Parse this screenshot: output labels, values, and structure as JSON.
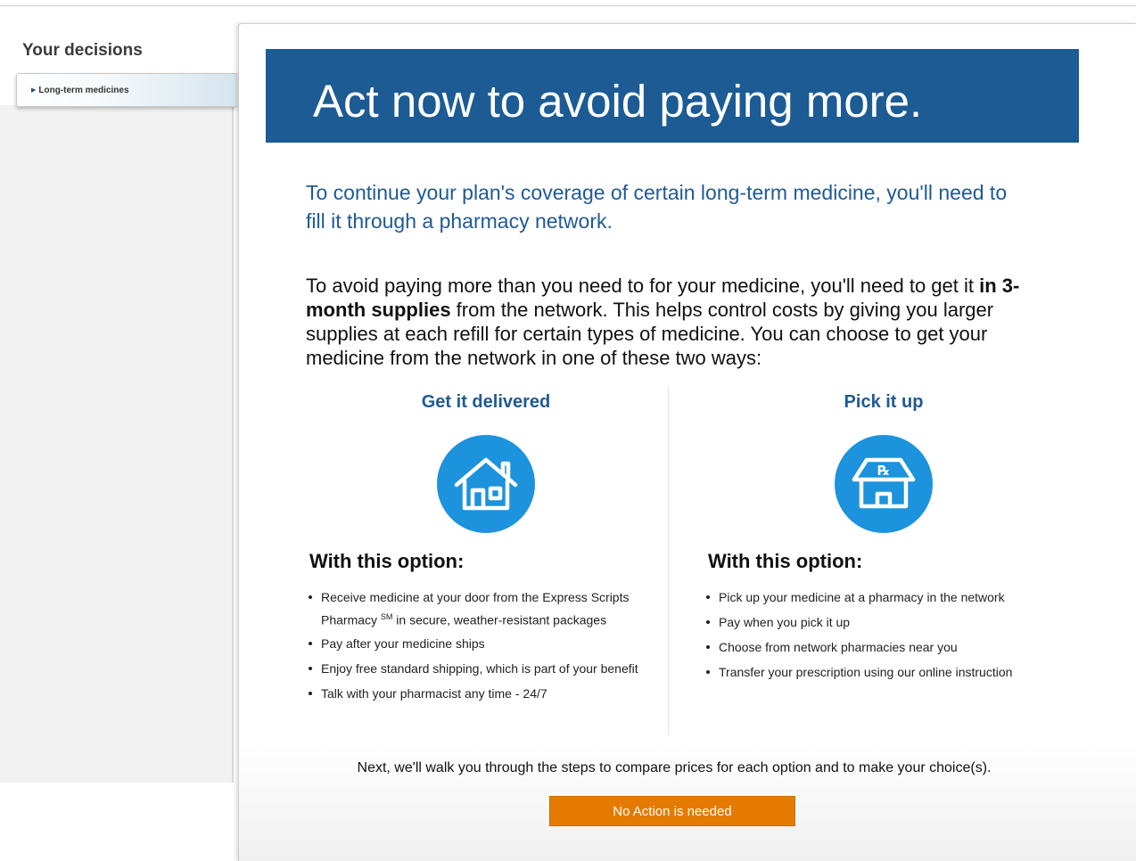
{
  "sidebar": {
    "title": "Your decisions",
    "items": [
      {
        "label": "Long-term medicines"
      }
    ]
  },
  "banner": {
    "title": "Act now to avoid paying more."
  },
  "main": {
    "lead": "To continue your plan's coverage of certain long-term medicine, you'll need to fill it through a pharmacy network.",
    "body_before_bold": "To avoid paying more than you need to for your medicine, you'll need to get it ",
    "body_bold": "in 3-month supplies",
    "body_after_bold": " from the network. This helps control costs by giving you larger supplies at each refill for certain types of medicine. You can choose to get your medicine from the network in one of these two ways:",
    "options": [
      {
        "title": "Get it delivered",
        "icon": "house-icon",
        "subtitle": "With this option:",
        "bullets": [
          "Receive medicine at your door from the Express Scripts Pharmacy",
          "Pay after your medicine ships",
          "Enjoy free standard shipping, which is part of your benefit",
          "Talk with your pharmacist any time - 24/7"
        ],
        "bullet1_sup": "SM",
        "bullet1_tail": " in secure, weather-resistant packages"
      },
      {
        "title": "Pick it up",
        "icon": "pharmacy-store-icon",
        "icon_text": "℞",
        "subtitle": "With this option:",
        "bullets": [
          "Pick up your medicine at a pharmacy in the network",
          "Pay when you pick it up",
          "Choose from network pharmacies near you",
          "Transfer your prescription using our online instruction"
        ]
      }
    ],
    "next_text": "Next, we'll walk you through the steps to compare prices for each option and to make your choice(s).",
    "action_button": "No Action is needed"
  },
  "colors": {
    "banner": "#1c5b94",
    "accent_text": "#1f5a95",
    "icon_circle": "#1c93dc",
    "action_button": "#e57a00"
  }
}
